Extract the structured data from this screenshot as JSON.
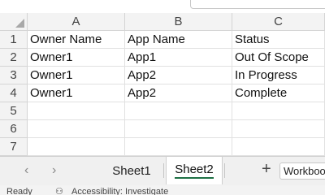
{
  "columns": [
    "A",
    "B",
    "C"
  ],
  "rows": [
    "1",
    "2",
    "3",
    "4",
    "5",
    "6",
    "7"
  ],
  "cells": [
    [
      "Owner Name",
      "App Name",
      "Status"
    ],
    [
      "Owner1",
      "App1",
      "Out Of Scope"
    ],
    [
      "Owner1",
      "App2",
      "In Progress"
    ],
    [
      "Owner1",
      "App2",
      "Complete"
    ]
  ],
  "sheet_tabs": {
    "prev_icon": "‹",
    "next_icon": "›",
    "tabs": [
      {
        "label": "Sheet1"
      },
      {
        "label": "Sheet2",
        "active": true
      }
    ],
    "add_icon": "+",
    "workbook_status": "Workbook Statistics"
  },
  "status_bar": {
    "ready": "Ready",
    "accessibility": "Accessibility: Investigate"
  },
  "colors": {
    "active_tab_underline": "#1e7145",
    "header_bg": "#f3f3f3"
  }
}
